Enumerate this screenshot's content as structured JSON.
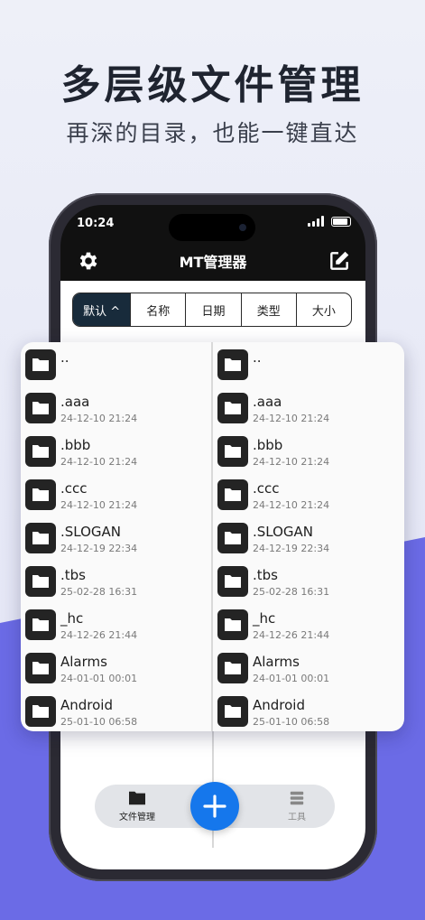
{
  "promo": {
    "headline": "多层级文件管理",
    "subline": "再深的目录，也能一键直达"
  },
  "status_bar": {
    "time": "10:24"
  },
  "app": {
    "title": "MT管理器",
    "settings_icon": "gear-icon",
    "edit_icon": "edit-icon"
  },
  "sort_tabs": [
    {
      "label": "默认 ^",
      "active": true
    },
    {
      "label": "名称",
      "active": false
    },
    {
      "label": "日期",
      "active": false
    },
    {
      "label": "类型",
      "active": false
    },
    {
      "label": "大小",
      "active": false
    }
  ],
  "left_pane": {
    "files": [
      {
        "name": "..",
        "date": ""
      },
      {
        "name": ".aaa",
        "date": "24-12-10 21:24"
      },
      {
        "name": ".bbb",
        "date": "24-12-10 21:24"
      },
      {
        "name": ".ccc",
        "date": "24-12-10 21:24"
      },
      {
        "name": ".SLOGAN",
        "date": "24-12-19 22:34"
      },
      {
        "name": ".tbs",
        "date": "25-02-28 16:31"
      },
      {
        "name": "_hc",
        "date": "24-12-26 21:44"
      },
      {
        "name": "Alarms",
        "date": "24-01-01 00:01"
      },
      {
        "name": "Android",
        "date": "25-01-10 06:58"
      }
    ]
  },
  "right_pane": {
    "files": [
      {
        "name": "..",
        "date": ""
      },
      {
        "name": ".aaa",
        "date": "24-12-10 21:24"
      },
      {
        "name": ".bbb",
        "date": "24-12-10 21:24"
      },
      {
        "name": ".ccc",
        "date": "24-12-10 21:24"
      },
      {
        "name": ".SLOGAN",
        "date": "24-12-19 22:34"
      },
      {
        "name": ".tbs",
        "date": "25-02-28 16:31"
      },
      {
        "name": "_hc",
        "date": "24-12-26 21:44"
      },
      {
        "name": "Alarms",
        "date": "24-01-01 00:01"
      },
      {
        "name": "Android",
        "date": "25-01-10 06:58"
      }
    ]
  },
  "bottom_nav": {
    "files_label": "文件管理",
    "tools_label": "工具",
    "add_icon": "plus-icon"
  },
  "colors": {
    "accent": "#1577ec",
    "active_tab": "#182b3b",
    "background_purple": "#6b6be6"
  }
}
